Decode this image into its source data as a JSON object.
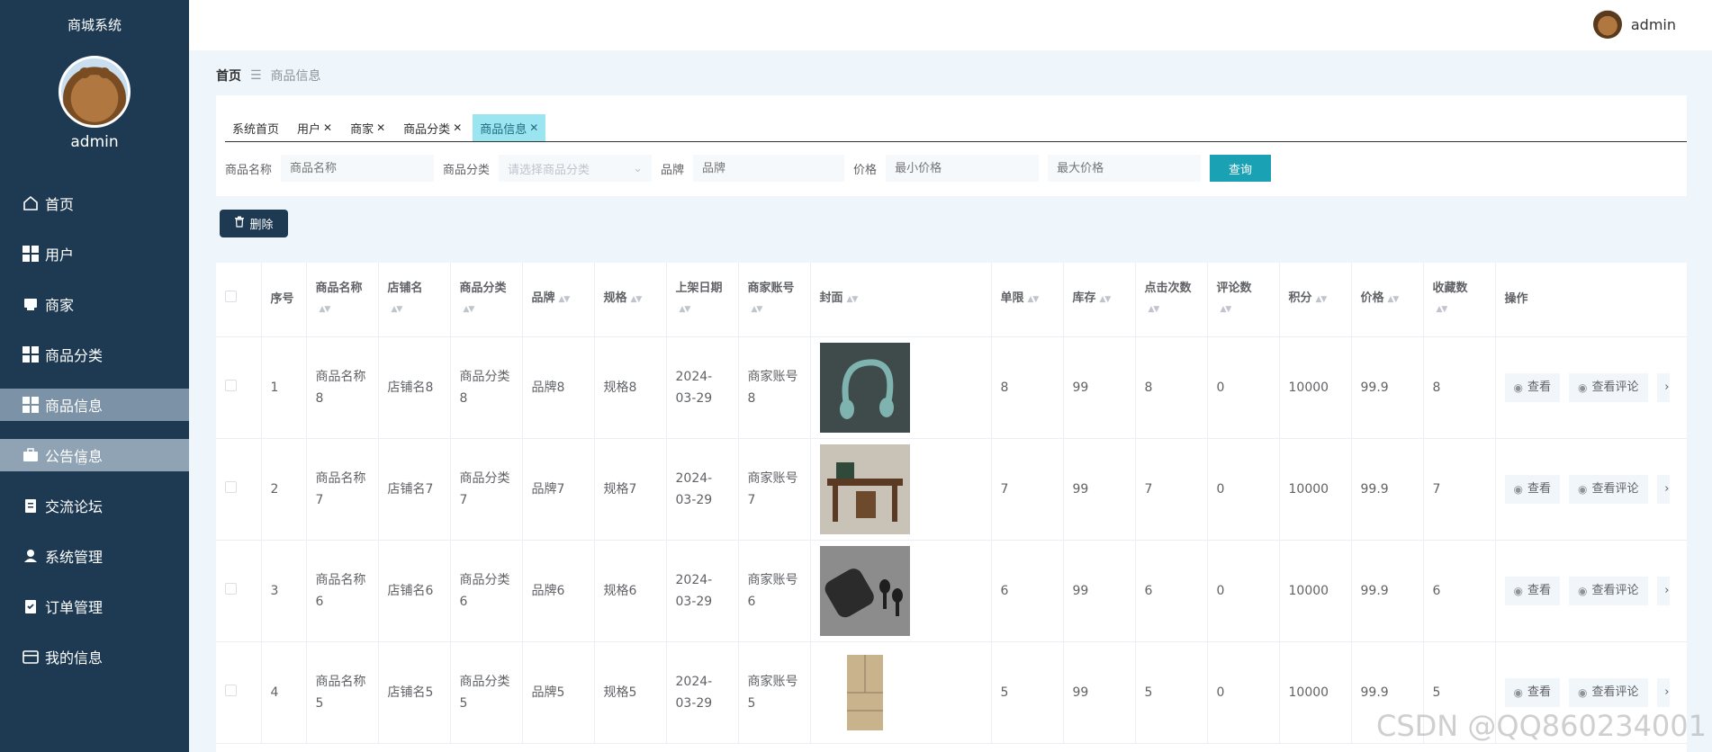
{
  "sidebar": {
    "title": "商城系统",
    "username": "admin",
    "items": [
      {
        "label": "首页",
        "icon": "home-icon"
      },
      {
        "label": "用户",
        "icon": "grid-icon"
      },
      {
        "label": "商家",
        "icon": "store-icon"
      },
      {
        "label": "商品分类",
        "icon": "grid-icon"
      },
      {
        "label": "商品信息",
        "icon": "grid-icon"
      },
      {
        "label": "公告信息",
        "icon": "briefcase-icon"
      },
      {
        "label": "交流论坛",
        "icon": "clipboard-icon"
      },
      {
        "label": "系统管理",
        "icon": "user-icon"
      },
      {
        "label": "订单管理",
        "icon": "checklist-icon"
      },
      {
        "label": "我的信息",
        "icon": "card-icon"
      }
    ]
  },
  "header": {
    "username": "admin"
  },
  "breadcrumb": {
    "home": "首页",
    "separator": "☰",
    "current": "商品信息"
  },
  "tabs": [
    {
      "label": "系统首页",
      "closable": false
    },
    {
      "label": "用户",
      "closable": true
    },
    {
      "label": "商家",
      "closable": true
    },
    {
      "label": "商品分类",
      "closable": true
    },
    {
      "label": "商品信息",
      "closable": true
    }
  ],
  "filters": {
    "name_label": "商品名称",
    "name_placeholder": "商品名称",
    "category_label": "商品分类",
    "category_placeholder": "请选择商品分类",
    "brand_label": "品牌",
    "brand_placeholder": "品牌",
    "price_label": "价格",
    "min_price_placeholder": "最小价格",
    "max_price_placeholder": "最大价格",
    "query_label": "查询"
  },
  "toolbar": {
    "delete_label": "删除"
  },
  "table": {
    "columns": {
      "index": "序号",
      "name": "商品名称",
      "shop": "店铺名",
      "category": "商品分类",
      "brand": "品牌",
      "spec": "规格",
      "date": "上架日期",
      "account": "商家账号",
      "cover": "封面",
      "limit": "单限",
      "stock": "库存",
      "clicks": "点击次数",
      "reviews": "评论数",
      "points": "积分",
      "price": "价格",
      "favorites": "收藏数",
      "actions": "操作"
    },
    "rows": [
      {
        "index": "1",
        "name": "商品名称8",
        "shop": "店铺名8",
        "category": "商品分类8",
        "brand": "品牌8",
        "spec": "规格8",
        "date": "2024-03-29",
        "account": "商家账号8",
        "cover": "headphones",
        "limit": "8",
        "stock": "99",
        "clicks": "8",
        "reviews": "0",
        "points": "10000",
        "price": "99.9",
        "favorites": "8"
      },
      {
        "index": "2",
        "name": "商品名称7",
        "shop": "店铺名7",
        "category": "商品分类7",
        "brand": "品牌7",
        "spec": "规格7",
        "date": "2024-03-29",
        "account": "商家账号7",
        "cover": "desk",
        "limit": "7",
        "stock": "99",
        "clicks": "7",
        "reviews": "0",
        "points": "10000",
        "price": "99.9",
        "favorites": "7"
      },
      {
        "index": "3",
        "name": "商品名称6",
        "shop": "店铺名6",
        "category": "商品分类6",
        "brand": "品牌6",
        "spec": "规格6",
        "date": "2024-03-29",
        "account": "商家账号6",
        "cover": "earbuds",
        "limit": "6",
        "stock": "99",
        "clicks": "6",
        "reviews": "0",
        "points": "10000",
        "price": "99.9",
        "favorites": "6"
      },
      {
        "index": "4",
        "name": "商品名称5",
        "shop": "店铺名5",
        "category": "商品分类5",
        "brand": "品牌5",
        "spec": "规格5",
        "date": "2024-03-29",
        "account": "商家账号5",
        "cover": "fridge",
        "limit": "5",
        "stock": "99",
        "clicks": "5",
        "reviews": "0",
        "points": "10000",
        "price": "99.9",
        "favorites": "5"
      }
    ],
    "actions": {
      "view": "查看",
      "view_reviews": "查看评论",
      "more": "›"
    }
  },
  "watermark": "CSDN @QQ860234001"
}
